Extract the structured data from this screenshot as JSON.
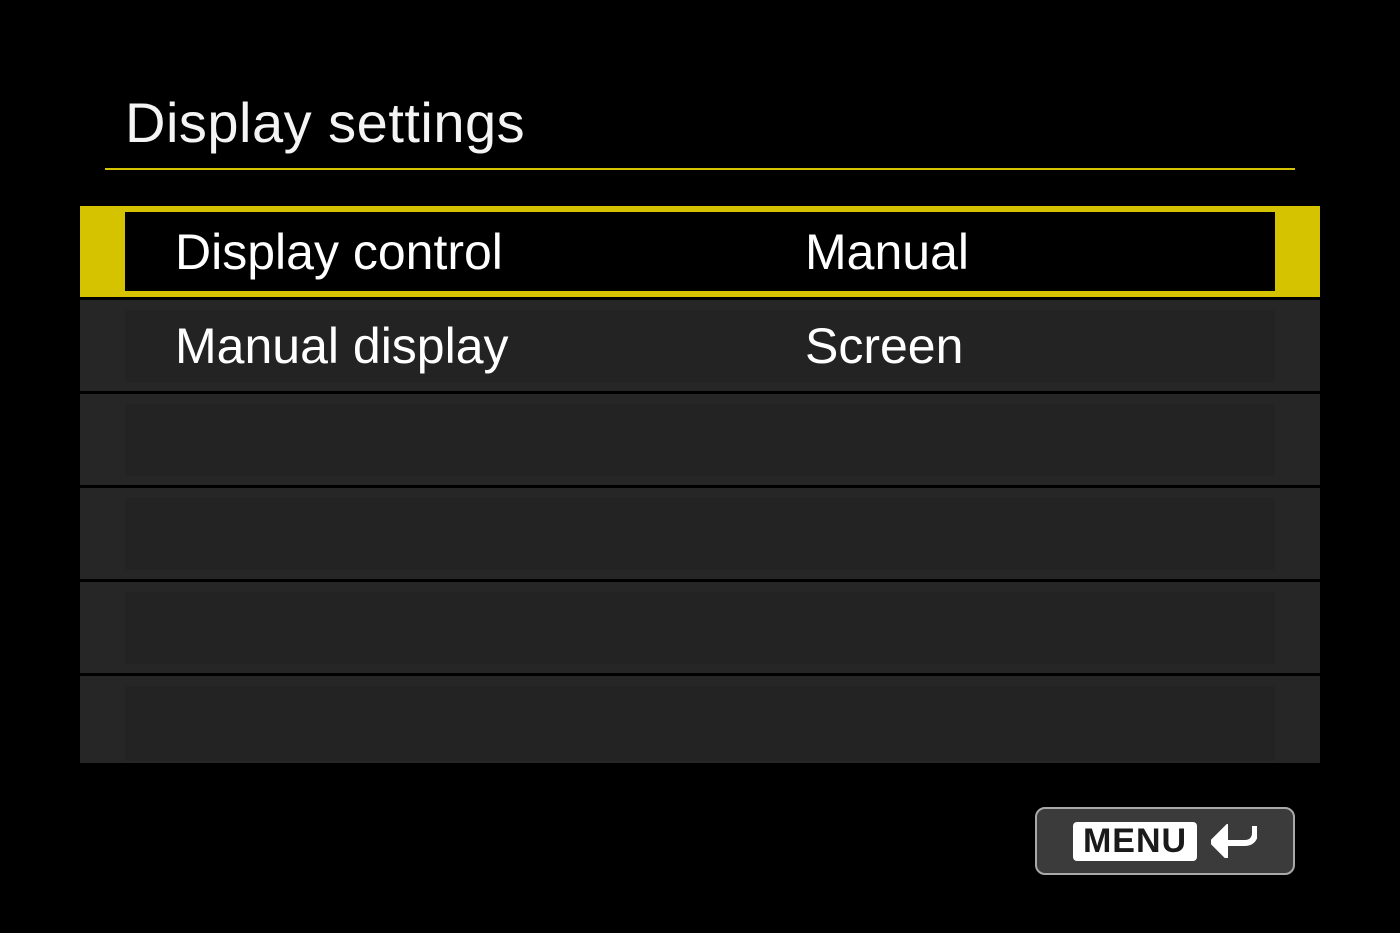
{
  "title": "Display settings",
  "rows": [
    {
      "label": "Display control",
      "value": "Manual",
      "selected": true
    },
    {
      "label": "Manual display",
      "value": "Screen",
      "selected": false
    },
    {
      "label": "",
      "value": "",
      "selected": false
    },
    {
      "label": "",
      "value": "",
      "selected": false
    },
    {
      "label": "",
      "value": "",
      "selected": false
    },
    {
      "label": "",
      "value": "",
      "selected": false
    }
  ],
  "menu_button": {
    "text": "MENU"
  },
  "colors": {
    "accent": "#d6c300",
    "bg": "#000000",
    "row_bg": "#262626",
    "text": "#ffffff"
  }
}
